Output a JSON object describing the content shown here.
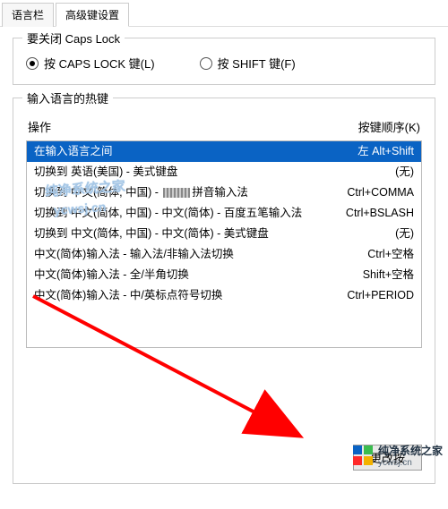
{
  "tabs": {
    "t0": "语言栏",
    "t1": "高级键设置",
    "active": 1
  },
  "caps_group": {
    "title": "要关闭 Caps Lock",
    "opt_caps": "按 CAPS LOCK 键(L)",
    "opt_shift": "按 SHIFT 键(F)",
    "selected": "caps"
  },
  "hotkey_group": {
    "title": "输入语言的热键",
    "col_action": "操作",
    "col_keys": "按键顺序(K)",
    "rows": [
      {
        "action": "在输入语言之间",
        "keys": "左 Alt+Shift",
        "selected": true
      },
      {
        "action": "切换到 英语(美国) - 美式键盘",
        "keys": "(无)"
      },
      {
        "action": "切换到 中文(简体, 中国) - ▒▒拼音输入法",
        "keys": "Ctrl+COMMA",
        "obscured": true
      },
      {
        "action": "切换到 中文(简体, 中国) - 中文(简体) - 百度五笔输入法",
        "keys": "Ctrl+BSLASH"
      },
      {
        "action": "切换到 中文(简体, 中国) - 中文(简体) - 美式键盘",
        "keys": "(无)"
      },
      {
        "action": "中文(简体)输入法 - 输入法/非输入法切换",
        "keys": "Ctrl+空格"
      },
      {
        "action": "中文(简体)输入法 - 全/半角切换",
        "keys": "Shift+空格"
      },
      {
        "action": "中文(简体)输入法 - 中/英标点符号切换",
        "keys": "Ctrl+PERIOD"
      }
    ],
    "change_button": "更改按"
  },
  "watermark": {
    "text": "纯净系统之家",
    "url": "ycwsj.cn"
  },
  "annotation": {
    "arrow_color": "#ff0000"
  }
}
